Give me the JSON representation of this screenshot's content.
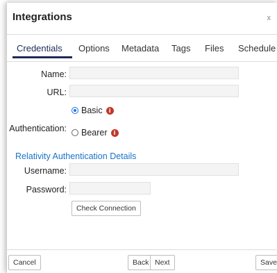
{
  "dialog": {
    "title": "Integrations",
    "close_label": "x"
  },
  "tabs": [
    {
      "label": "Credentials"
    },
    {
      "label": "Options"
    },
    {
      "label": "Metadata"
    },
    {
      "label": "Tags"
    },
    {
      "label": "Files"
    },
    {
      "label": "Schedule"
    }
  ],
  "form": {
    "name_label": "Name:",
    "name_value": "",
    "url_label": "URL:",
    "url_value": "",
    "authentication_label": "Authentication:",
    "auth_options": [
      {
        "label": "Basic",
        "selected": true
      },
      {
        "label": "Bearer",
        "selected": false
      }
    ],
    "section_heading": "Relativity Authentication Details",
    "username_label": "Username:",
    "username_value": "",
    "password_label": "Password:",
    "password_value": "",
    "check_connection_label": "Check Connection"
  },
  "footer": {
    "cancel_label": "Cancel",
    "back_label": "Back",
    "next_label": "Next",
    "save_label": "Save"
  },
  "icons": {
    "info": "info-icon",
    "info_color": "#c0392b",
    "accent": "#1e2a5a",
    "link_color": "#1a73c8"
  }
}
